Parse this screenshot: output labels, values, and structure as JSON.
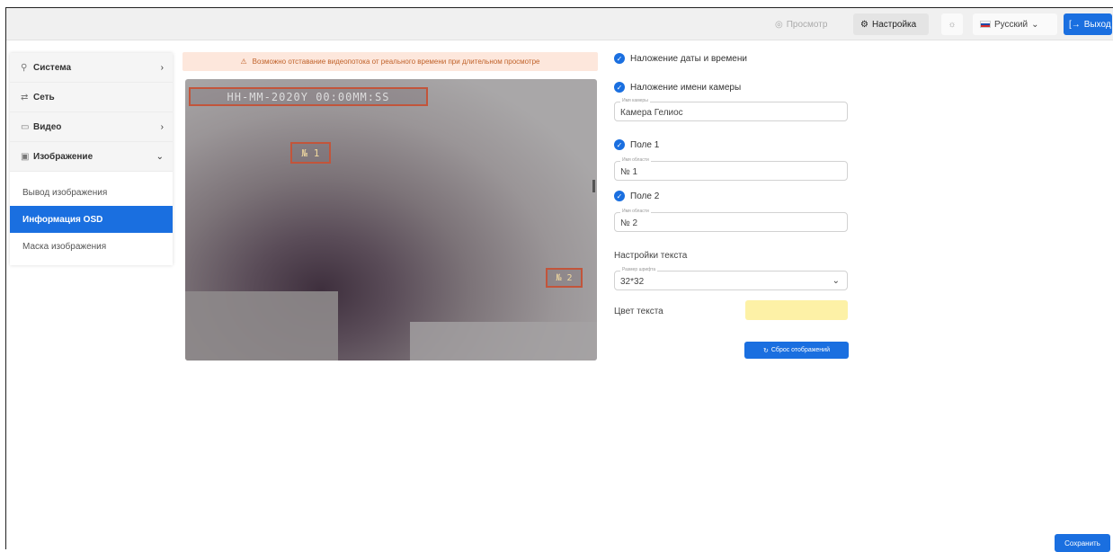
{
  "topbar": {
    "preview_label": "Просмотр",
    "settings_label": "Настройка",
    "language_label": "Русский",
    "logout_label": "Выход"
  },
  "sidebar": {
    "items": [
      {
        "label": "Система",
        "icon": "wrench-icon"
      },
      {
        "label": "Сеть",
        "icon": "network-icon"
      },
      {
        "label": "Видео",
        "icon": "video-icon"
      },
      {
        "label": "Изображение",
        "icon": "image-icon"
      }
    ],
    "subitems": [
      {
        "label": "Вывод изображения"
      },
      {
        "label": "Информация OSD",
        "active": true
      },
      {
        "label": "Маска изображения"
      }
    ]
  },
  "warning": {
    "text": "Возможно отставание видеопотока от реального времени при длительном просмотре"
  },
  "video": {
    "osd_datetime": "HH-MM-2020Y 00:00MM:SS",
    "osd_field1": "№ 1",
    "osd_field2": "№ 2"
  },
  "form": {
    "datetime_overlay_label": "Наложение даты и времени",
    "camera_name_overlay_label": "Наложение имени камеры",
    "camera_name_field_label": "Имя камеры",
    "camera_name_value": "Камера Гелиос",
    "field1_label": "Поле 1",
    "field1_area_label": "Имя области",
    "field1_value": "№ 1",
    "field2_label": "Поле 2",
    "field2_area_label": "Имя области",
    "field2_value": "№ 2",
    "text_settings_label": "Настройки текста",
    "font_size_label": "Размер шрифта",
    "font_size_value": "32*32",
    "text_color_label": "Цвет текста",
    "text_color_value": "#fdf1a6",
    "reset_button": "Сброс отображений"
  },
  "footer": {
    "save_button": "Сохранить"
  },
  "colors": {
    "accent": "#1a6fe0",
    "warning_bg": "#fde7dc",
    "osd_border": "#c2553b"
  }
}
